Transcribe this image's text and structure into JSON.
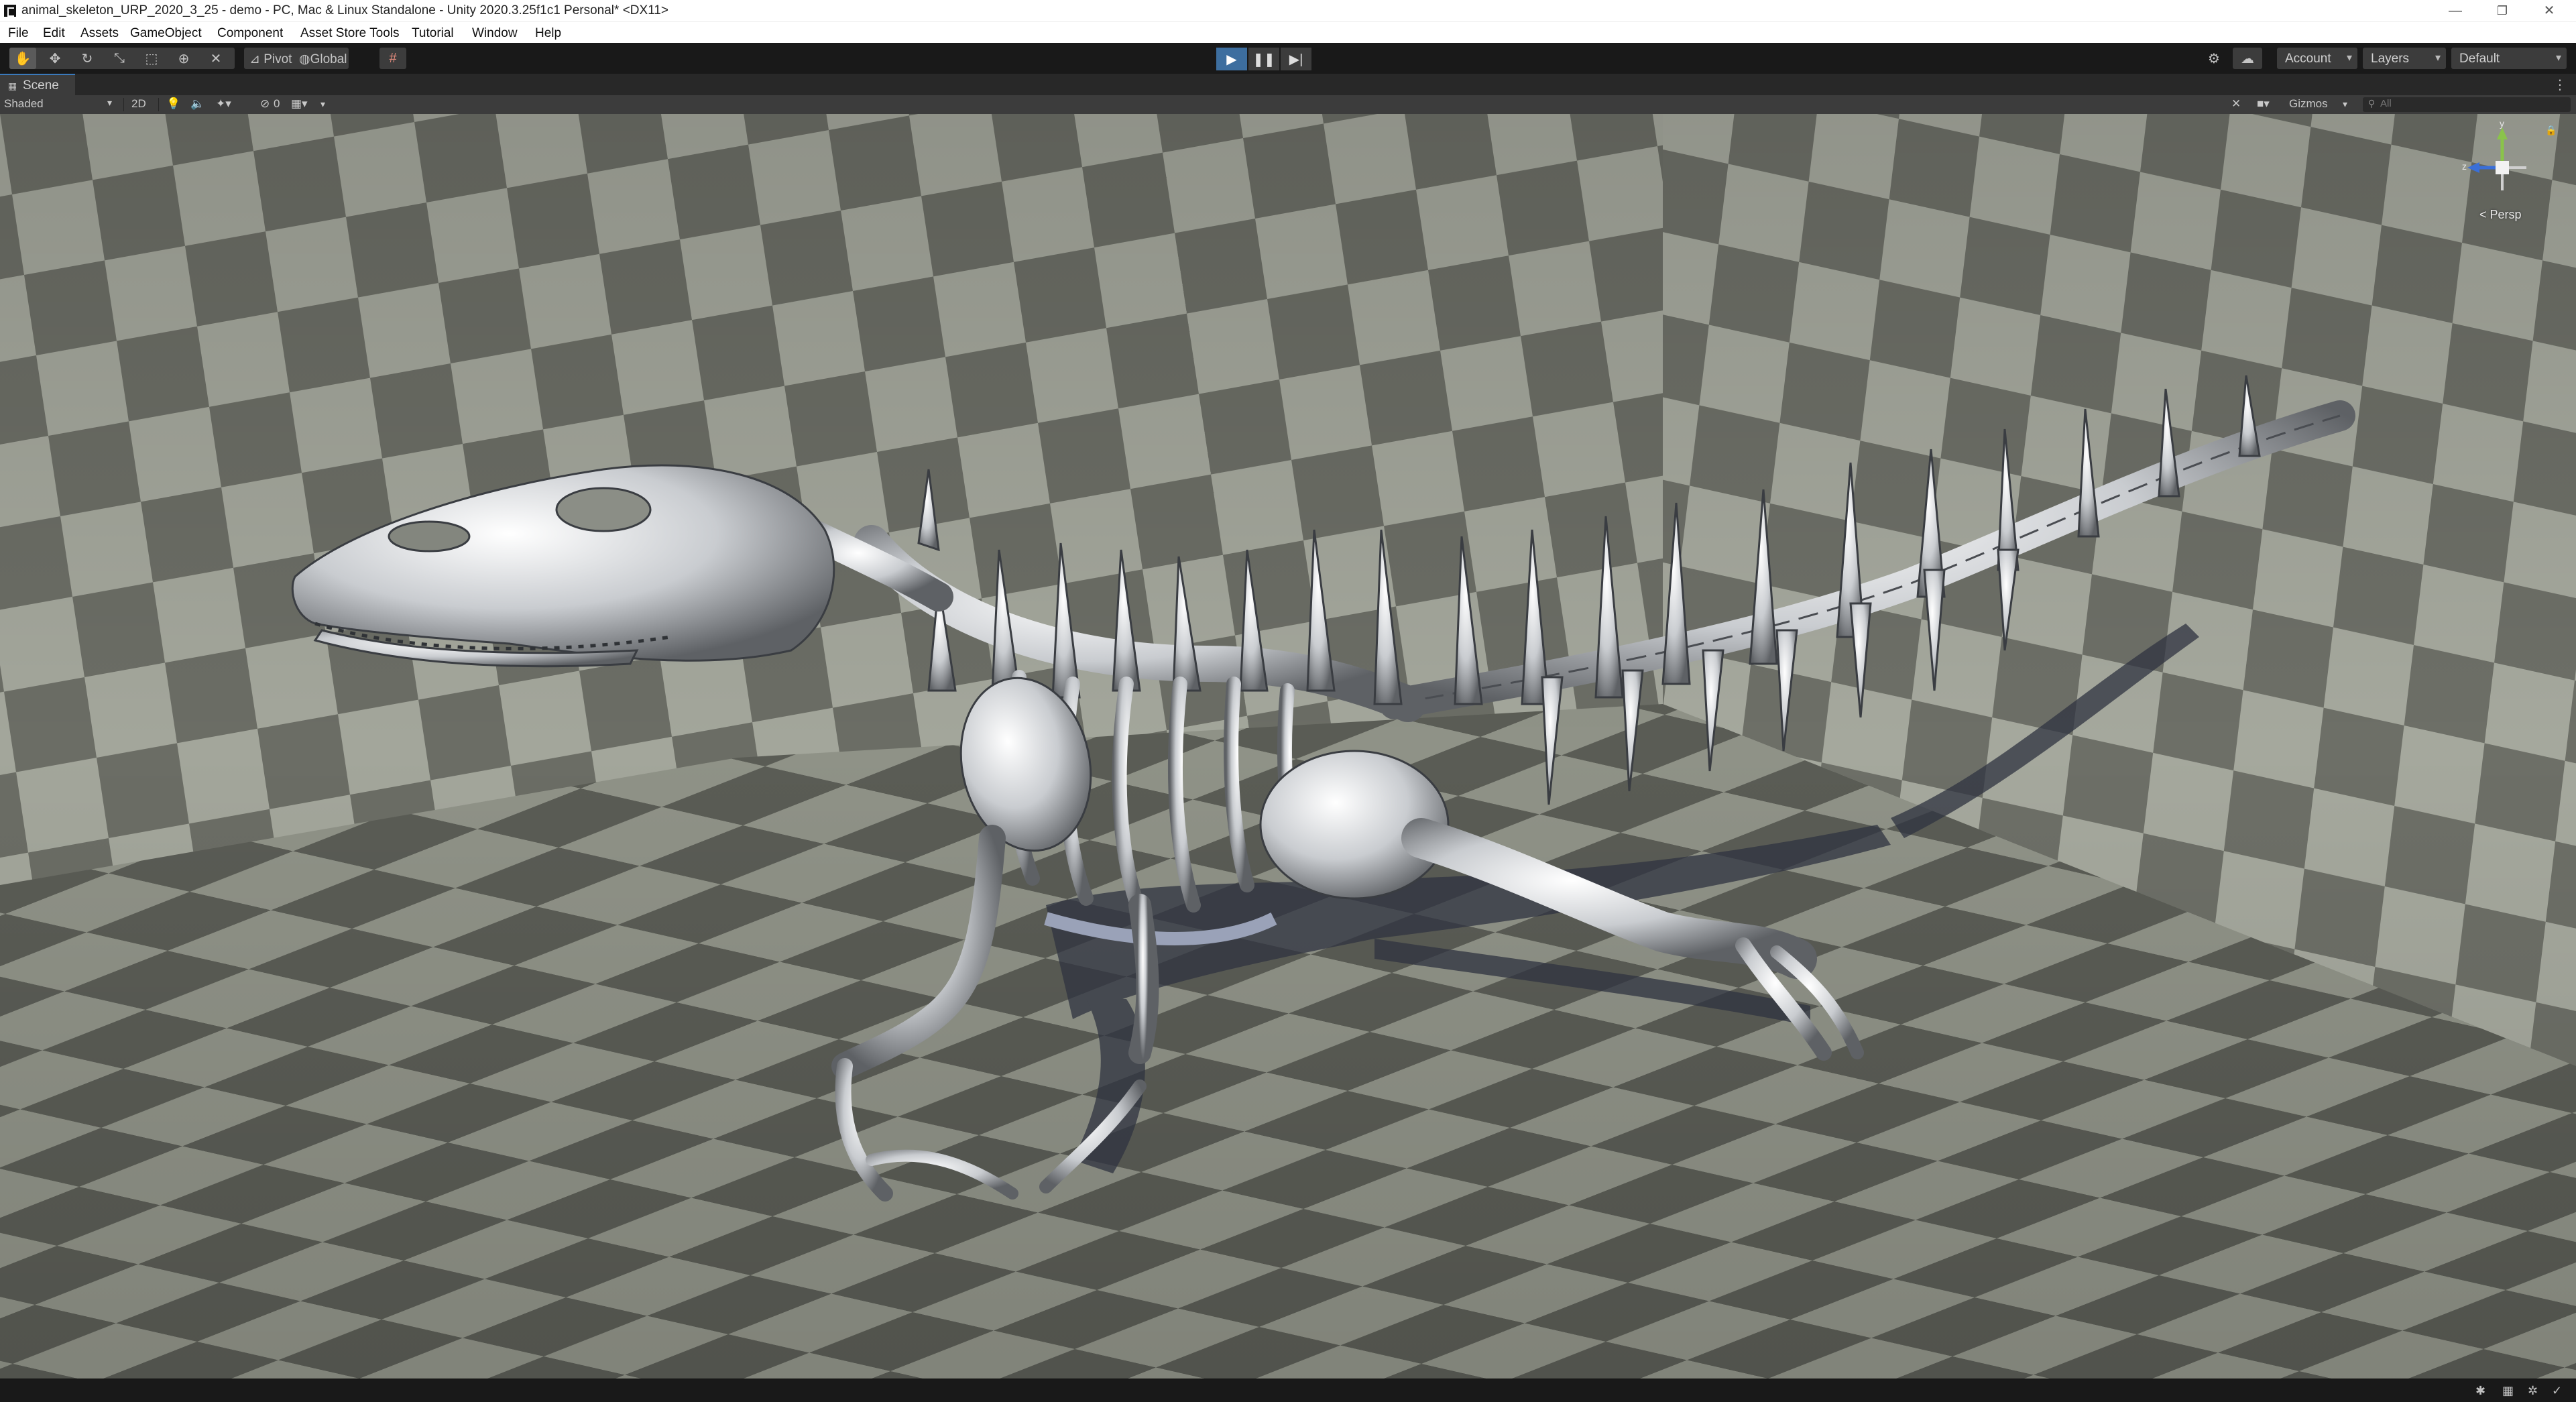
{
  "window": {
    "title": "animal_skeleton_URP_2020_3_25 - demo - PC, Mac & Linux Standalone - Unity 2020.3.25f1c1 Personal* <DX11>",
    "minimize": "—",
    "restore": "❐",
    "close": "✕"
  },
  "menu": [
    "File",
    "Edit",
    "Assets",
    "GameObject",
    "Component",
    "Asset Store Tools",
    "Tutorial",
    "Window",
    "Help"
  ],
  "toolbar": {
    "pivot": "Pivot",
    "global": "Global",
    "account": "Account",
    "layers": "Layers",
    "layout": "Default"
  },
  "tab": {
    "scene": "Scene",
    "more": "⋮"
  },
  "scenebar": {
    "shading_mode": "Shaded",
    "two_d": "2D",
    "hidden_count": "0",
    "gizmos": "Gizmos",
    "search_placeholder": "All"
  },
  "gizmo": {
    "y": "y",
    "z": "z",
    "projection": "< Persp"
  },
  "colors": {
    "accent": "#3a79bb",
    "play_active": "#3d6e9f",
    "checker_light": "#9a9d92",
    "checker_dark": "#555750"
  }
}
